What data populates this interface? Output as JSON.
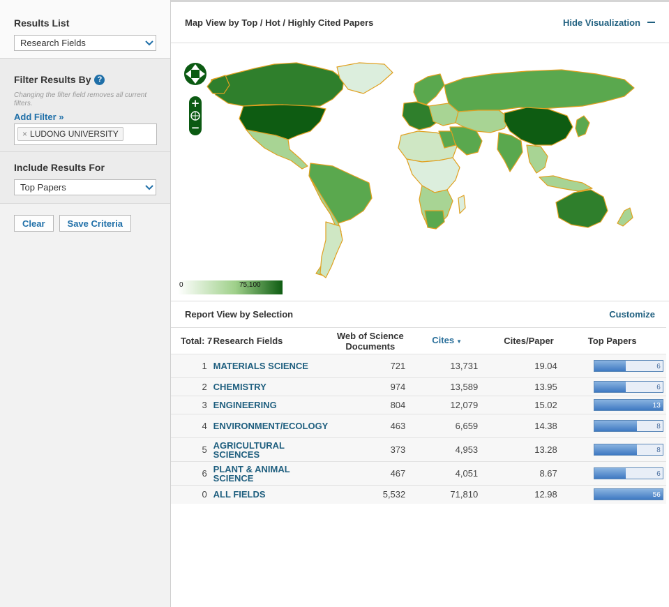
{
  "sidebar": {
    "results_list": {
      "title": "Results List",
      "selected": "Research Fields"
    },
    "filter": {
      "title": "Filter Results By",
      "help": "?",
      "hint": "Changing the filter field removes all current filters.",
      "add_filter": "Add Filter »",
      "chips": [
        {
          "remove": "×",
          "label": "LUDONG UNIVERSITY"
        }
      ]
    },
    "include": {
      "title": "Include Results For",
      "selected": "Top Papers"
    },
    "buttons": {
      "clear": "Clear",
      "save": "Save Criteria"
    }
  },
  "map": {
    "title": "Map View by Top / Hot / Highly Cited Papers",
    "hide_label": "Hide Visualization",
    "legend_min": "0",
    "legend_max": "75,100",
    "colors": {
      "dark": "#0e5c12",
      "mid": "#5aa84e",
      "light": "#a8d494",
      "pale": "#dceedd",
      "border": "#e0a020",
      "control": "#0b5a12"
    }
  },
  "report": {
    "title": "Report View by Selection",
    "customize": "Customize",
    "headers": {
      "total": "Total: 7",
      "field": "Research Fields",
      "docs": "Web of Science Documents",
      "cites": "Cites",
      "cpp": "Cites/Paper",
      "top": "Top Papers"
    },
    "rows": [
      {
        "rank": "1",
        "field": "MATERIALS SCIENCE",
        "docs": "721",
        "cites": "13,731",
        "cpp": "19.04",
        "top": "6",
        "top_fraction": 0.46
      },
      {
        "rank": "2",
        "field": "CHEMISTRY",
        "docs": "974",
        "cites": "13,589",
        "cpp": "13.95",
        "top": "6",
        "top_fraction": 0.46
      },
      {
        "rank": "3",
        "field": "ENGINEERING",
        "docs": "804",
        "cites": "12,079",
        "cpp": "15.02",
        "top": "13",
        "top_fraction": 1.0
      },
      {
        "rank": "4",
        "field": "ENVIRONMENT/ECOLOGY",
        "docs": "463",
        "cites": "6,659",
        "cpp": "14.38",
        "top": "8",
        "top_fraction": 0.62
      },
      {
        "rank": "5",
        "field": "AGRICULTURAL SCIENCES",
        "docs": "373",
        "cites": "4,953",
        "cpp": "13.28",
        "top": "8",
        "top_fraction": 0.62
      },
      {
        "rank": "6",
        "field": "PLANT & ANIMAL SCIENCE",
        "docs": "467",
        "cites": "4,051",
        "cpp": "8.67",
        "top": "6",
        "top_fraction": 0.46
      },
      {
        "rank": "0",
        "field": "ALL FIELDS",
        "docs": "5,532",
        "cites": "71,810",
        "cpp": "12.98",
        "top": "56",
        "top_fraction": 1.0
      }
    ]
  }
}
